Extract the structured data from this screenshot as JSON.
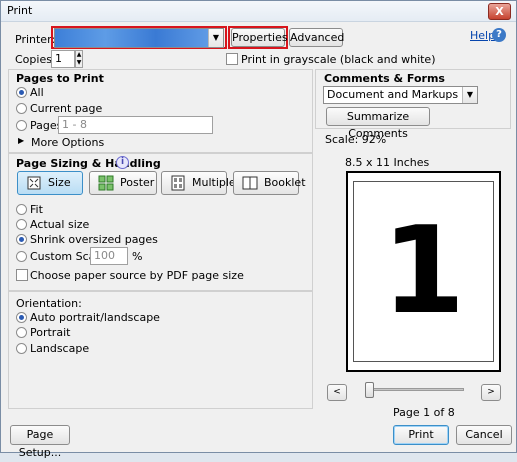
{
  "window": {
    "title": "Print",
    "close_glyph": "X"
  },
  "printer": {
    "label": "Printer:",
    "selected": "",
    "properties_label": "Properties",
    "advanced_label": "Advanced",
    "help_label": "Help",
    "help_glyph": "?",
    "copies_label": "Copies:",
    "copies_value": "1",
    "grayscale_label": "Print in grayscale (black and white)",
    "grayscale_checked": false
  },
  "pages_to_print": {
    "title": "Pages to Print",
    "options": [
      "All",
      "Current page",
      "Pages"
    ],
    "selected": "All",
    "pages_range_placeholder": "1 - 8",
    "more_options_label": "More Options"
  },
  "sizing": {
    "title": "Page Sizing & Handling",
    "info_glyph": "i",
    "modes": [
      "Size",
      "Poster",
      "Multiple",
      "Booklet"
    ],
    "active_mode": "Size",
    "options": [
      "Fit",
      "Actual size",
      "Shrink oversized pages",
      "Custom Scale:"
    ],
    "selected": "Shrink oversized pages",
    "custom_scale_value": "100",
    "percent_sign": "%",
    "paper_source_label": "Choose paper source by PDF page size",
    "paper_source_checked": false
  },
  "orientation": {
    "title": "Orientation:",
    "options": [
      "Auto portrait/landscape",
      "Portrait",
      "Landscape"
    ],
    "selected": "Auto portrait/landscape"
  },
  "comments_forms": {
    "title": "Comments & Forms",
    "selected": "Document and Markups",
    "summarize_label": "Summarize Comments"
  },
  "preview": {
    "scale_text": "Scale: 92%",
    "paper_size": "8.5 x 11 Inches",
    "page_glyph": "1",
    "page_indicator": "Page 1 of 8",
    "prev_glyph": "<",
    "next_glyph": ">",
    "current_page": 1,
    "total_pages": 8
  },
  "footer": {
    "page_setup_label": "Page Setup...",
    "print_label": "Print",
    "cancel_label": "Cancel"
  },
  "colors": {
    "highlight": "#d8141c",
    "printer_selection": "#3d7fd8",
    "accent_radio": "#2a5ab3"
  }
}
